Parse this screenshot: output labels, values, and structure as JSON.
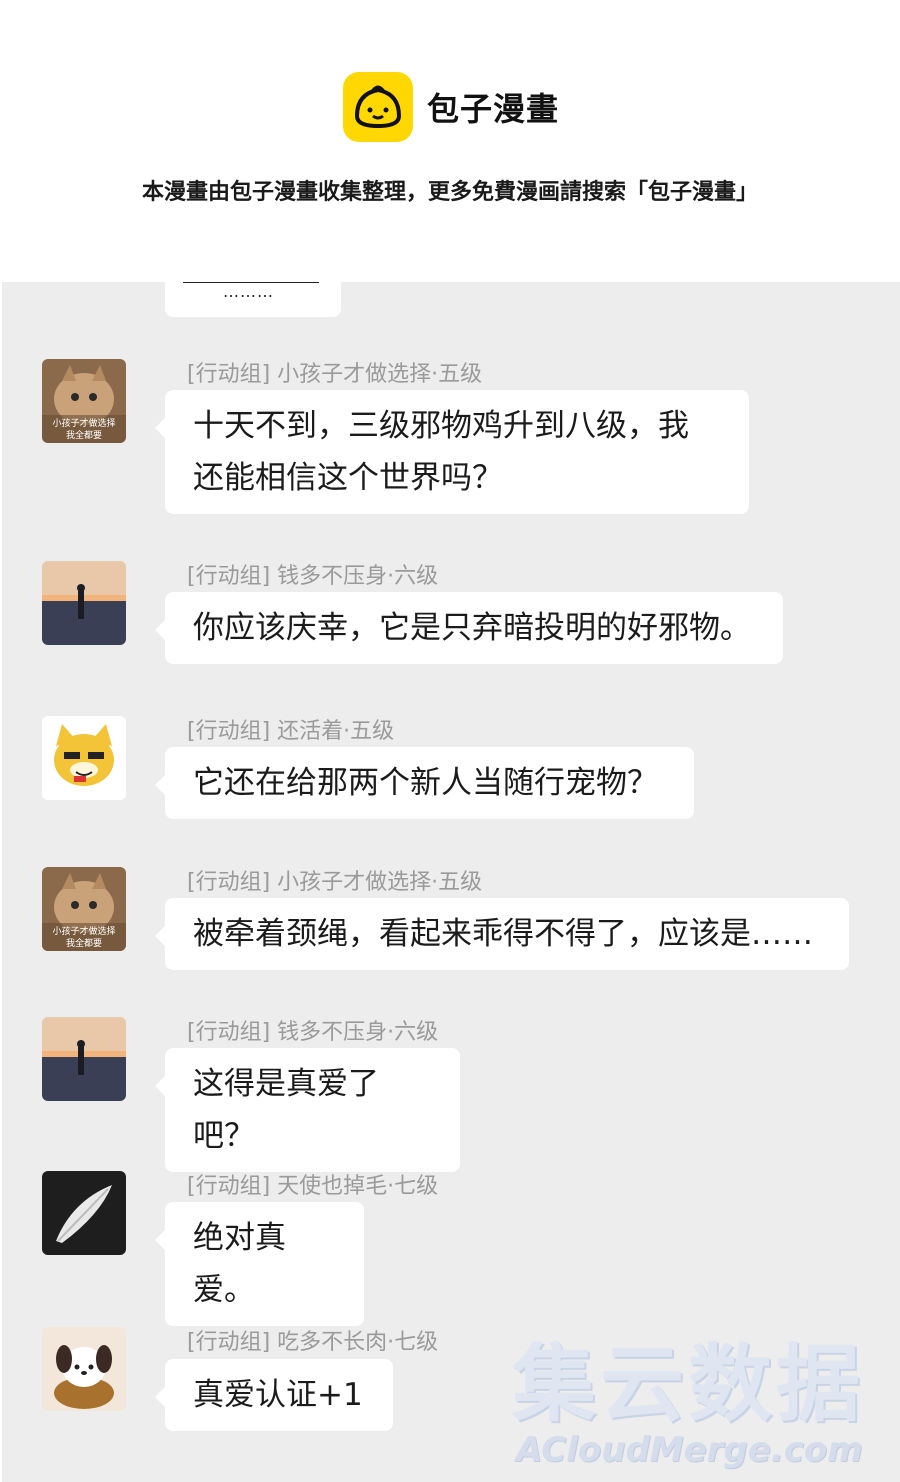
{
  "header": {
    "brand_name": "包子漫畫",
    "notice": "本漫畫由包子漫畫收集整理，更多免費漫画請搜索「包子漫畫」"
  },
  "chat": {
    "top_bubble_text": "………",
    "messages": [
      {
        "sender": "[行动组] 小孩子才做选择·五级",
        "text_lines": [
          "十天不到，三级邪物鸡升到八级，我",
          "还能相信这个世界吗？"
        ],
        "avatar": "cat-avatar",
        "avatar_caption": [
          "小孩子才做选择",
          "我全都要"
        ]
      },
      {
        "sender": "[行动组] 钱多不压身·六级",
        "text_lines": [
          "你应该庆幸，它是只弃暗投明的好邪物。"
        ],
        "avatar": "sunset-silhouette-avatar"
      },
      {
        "sender": "[行动组] 还活着·五级",
        "text_lines": [
          "它还在给那两个新人当随行宠物？"
        ],
        "avatar": "doge-avatar"
      },
      {
        "sender": "[行动组] 小孩子才做选择·五级",
        "text_lines": [
          "被牵着颈绳，看起来乖得不得了，应该是……"
        ],
        "avatar": "cat-avatar",
        "avatar_caption": [
          "小孩子才做选择",
          "我全都要"
        ]
      },
      {
        "sender": "[行动组] 钱多不压身·六级",
        "text_lines": [
          "这得是真爱了吧？"
        ],
        "avatar": "sunset-silhouette-avatar"
      },
      {
        "sender": "[行动组] 天使也掉毛·七级",
        "text_lines": [
          "绝对真爱。"
        ],
        "avatar": "feather-avatar"
      },
      {
        "sender": "[行动组] 吃多不长肉·七级",
        "text_lines": [
          "真爱认证+1"
        ],
        "avatar": "puppy-avatar"
      }
    ]
  },
  "watermark": {
    "chinese": "集云数据",
    "english": "ACloudMerge.com"
  }
}
